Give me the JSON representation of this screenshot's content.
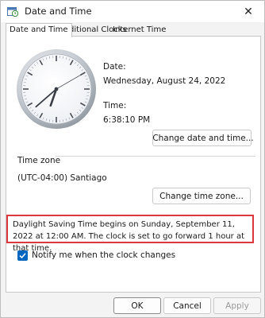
{
  "window": {
    "title": "Date and Time",
    "close_glyph": "✕"
  },
  "tabs": [
    {
      "label": "Date and Time",
      "active": true
    },
    {
      "label": "Additional Clocks",
      "active": false
    },
    {
      "label": "Internet Time",
      "active": false
    }
  ],
  "datetime": {
    "date_label": "Date:",
    "date_value": "Wednesday, August 24, 2022",
    "time_label": "Time:",
    "time_value": "6:38:10 PM",
    "change_button": "Change date and time..."
  },
  "clock": {
    "hours": 6,
    "minutes": 38,
    "seconds": 10
  },
  "timezone": {
    "heading": "Time zone",
    "value": "(UTC-04:00) Santiago",
    "change_button": "Change time zone..."
  },
  "dst": {
    "message": "Daylight Saving Time begins on Sunday, September 11, 2022 at 12:00 AM. The clock is set to go forward 1 hour at that time.",
    "highlight_color": "#d9393f"
  },
  "notify": {
    "label": "Notify me when the clock changes",
    "checked": true
  },
  "footer": {
    "ok": "OK",
    "cancel": "Cancel",
    "apply": "Apply"
  },
  "colors": {
    "accent": "#0067c0"
  }
}
